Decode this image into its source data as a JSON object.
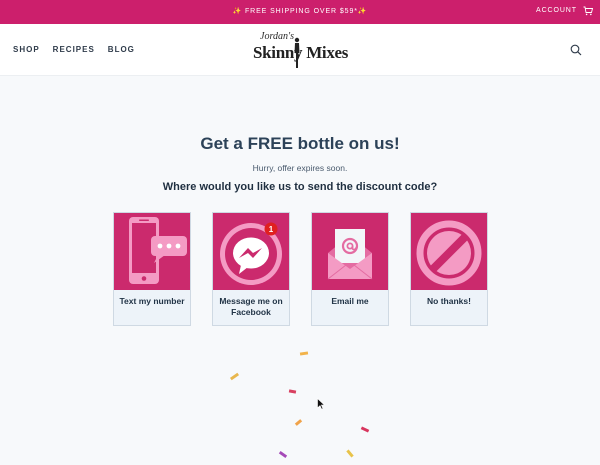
{
  "topbar": {
    "promo": "✨ FREE SHIPPING OVER $59*✨",
    "account": "ACCOUNT",
    "cart_icon": "cart-icon"
  },
  "header": {
    "nav": [
      "SHOP",
      "RECIPES",
      "BLOG"
    ],
    "logo": {
      "script": "Jordan's",
      "brand": "Skinny Mixes"
    },
    "search_icon": "search-icon"
  },
  "popup": {
    "title": "Get a FREE bottle on us!",
    "subtitle": "Hurry, offer expires soon.",
    "question": "Where would you like us to send the discount code?",
    "options": [
      {
        "label": "Text my number",
        "icon": "phone-chat-icon"
      },
      {
        "label": "Message me on Facebook",
        "icon": "messenger-icon",
        "badge": "1"
      },
      {
        "label": "Email me",
        "icon": "email-icon"
      },
      {
        "label": "No thanks!",
        "icon": "no-icon"
      }
    ]
  },
  "colors": {
    "brand": "#cc1f6c",
    "tile": "#cb2a6d",
    "title": "#2c4258"
  }
}
